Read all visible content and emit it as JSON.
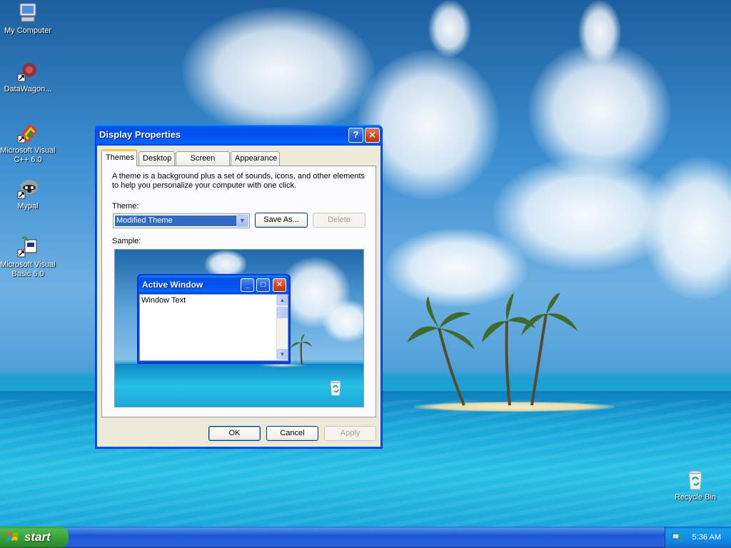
{
  "desktop": {
    "icons": [
      {
        "label": "My Computer",
        "icon": "my-computer-icon"
      },
      {
        "label": "DataWagon...",
        "icon": "datawagon-shortcut-icon"
      },
      {
        "label": "Microsoft Visual C++ 6.0",
        "icon": "visual-cpp-shortcut-icon"
      },
      {
        "label": "Mypal",
        "icon": "mypal-shortcut-icon"
      },
      {
        "label": "Microsoft Visual Basic 6.0",
        "icon": "visual-basic-shortcut-icon"
      },
      {
        "label": "Recycle Bin",
        "icon": "recycle-bin-icon"
      }
    ]
  },
  "dialog": {
    "title": "Display Properties",
    "help_label": "?",
    "close_label": "✕",
    "tabs": [
      {
        "label": "Themes",
        "active": true
      },
      {
        "label": "Desktop",
        "active": false
      },
      {
        "label": "Screen Saver",
        "active": false
      },
      {
        "label": "Appearance",
        "active": false
      }
    ],
    "description": "A theme is a background plus a set of sounds, icons, and other elements to help you personalize your computer with one click.",
    "theme_label": "Theme:",
    "theme_value": "Modified Theme",
    "save_as_label": "Save As...",
    "delete_label": "Delete",
    "sample_label": "Sample:",
    "sample": {
      "window_title": "Active Window",
      "window_text": "Window Text"
    },
    "ok_label": "OK",
    "cancel_label": "Cancel",
    "apply_label": "Apply"
  },
  "taskbar": {
    "start_label": "start",
    "clock": "5:36 AM"
  },
  "colors": {
    "title_blue": "#0054e3",
    "start_green": "#3c9a3c",
    "selection": "#316ac5",
    "tab_highlight": "#ffc83c"
  }
}
